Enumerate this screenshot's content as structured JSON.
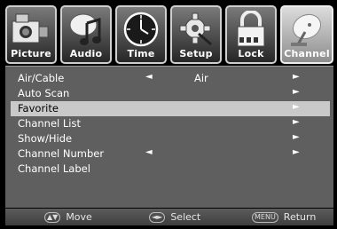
{
  "tabs": [
    {
      "label": "Picture",
      "icon": "camera-icon",
      "active": false
    },
    {
      "label": "Audio",
      "icon": "music-note-icon",
      "active": false
    },
    {
      "label": "Time",
      "icon": "clock-icon",
      "active": false
    },
    {
      "label": "Setup",
      "icon": "gear-icon",
      "active": false
    },
    {
      "label": "Lock",
      "icon": "padlock-icon",
      "active": false
    },
    {
      "label": "Channel",
      "icon": "satellite-dish-icon",
      "active": true
    }
  ],
  "menu": [
    {
      "label": "Air/Cable",
      "left_arrow": "◄",
      "value": "Air",
      "right_arrow": "►",
      "selected": false
    },
    {
      "label": "Auto Scan",
      "left_arrow": "",
      "value": "",
      "right_arrow": "►",
      "selected": false
    },
    {
      "label": "Favorite",
      "left_arrow": "",
      "value": "",
      "right_arrow": "►",
      "selected": true
    },
    {
      "label": "Channel List",
      "left_arrow": "",
      "value": "",
      "right_arrow": "►",
      "selected": false
    },
    {
      "label": "Show/Hide",
      "left_arrow": "",
      "value": "",
      "right_arrow": "►",
      "selected": false
    },
    {
      "label": "Channel Number",
      "left_arrow": "◄",
      "value": "",
      "right_arrow": "►",
      "selected": false
    },
    {
      "label": "Channel Label",
      "left_arrow": "",
      "value": "",
      "right_arrow": "",
      "selected": false
    }
  ],
  "hints": {
    "move_icon": "▲▼",
    "move": "Move",
    "select_icon": "◄►",
    "select": "Select",
    "return_icon": "MENU",
    "return": "Return"
  },
  "colors": {
    "panel_bg": "#5f5f5f",
    "selected_row": "#c9c9c9",
    "active_tab": "#bfbfbf"
  }
}
